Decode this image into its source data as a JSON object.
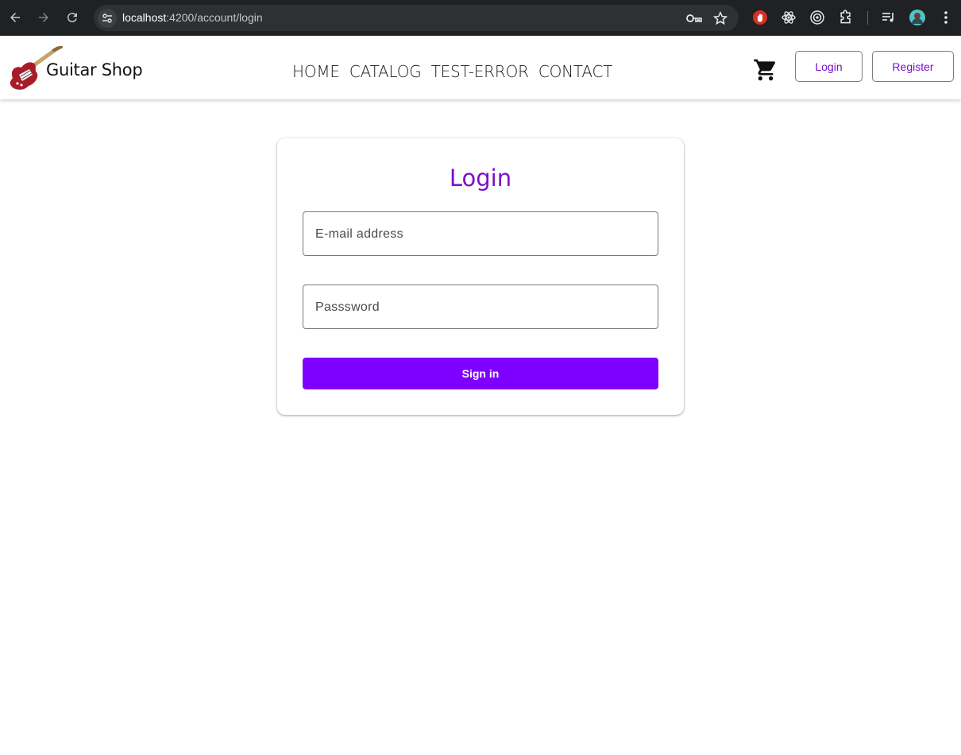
{
  "browser": {
    "url_host": "localhost",
    "url_rest": ":4200/account/login"
  },
  "header": {
    "brand": "Guitar Shop",
    "nav": [
      "HOME",
      "CATALOG",
      "TEST-ERROR",
      "CONTACT"
    ],
    "login_label": "Login",
    "register_label": "Register",
    "accent_color": "#7b10c8"
  },
  "login_form": {
    "title": "Login",
    "email_placeholder": "E-mail address",
    "password_placeholder": "Passsword",
    "submit_label": "Sign in",
    "primary_color": "#8000ff"
  },
  "icons": {
    "back": "arrow-left-icon",
    "forward": "arrow-right-icon",
    "reload": "reload-icon",
    "site_info": "tune-icon",
    "password_key": "key-icon",
    "bookmark": "star-icon",
    "cart": "cart-icon"
  }
}
